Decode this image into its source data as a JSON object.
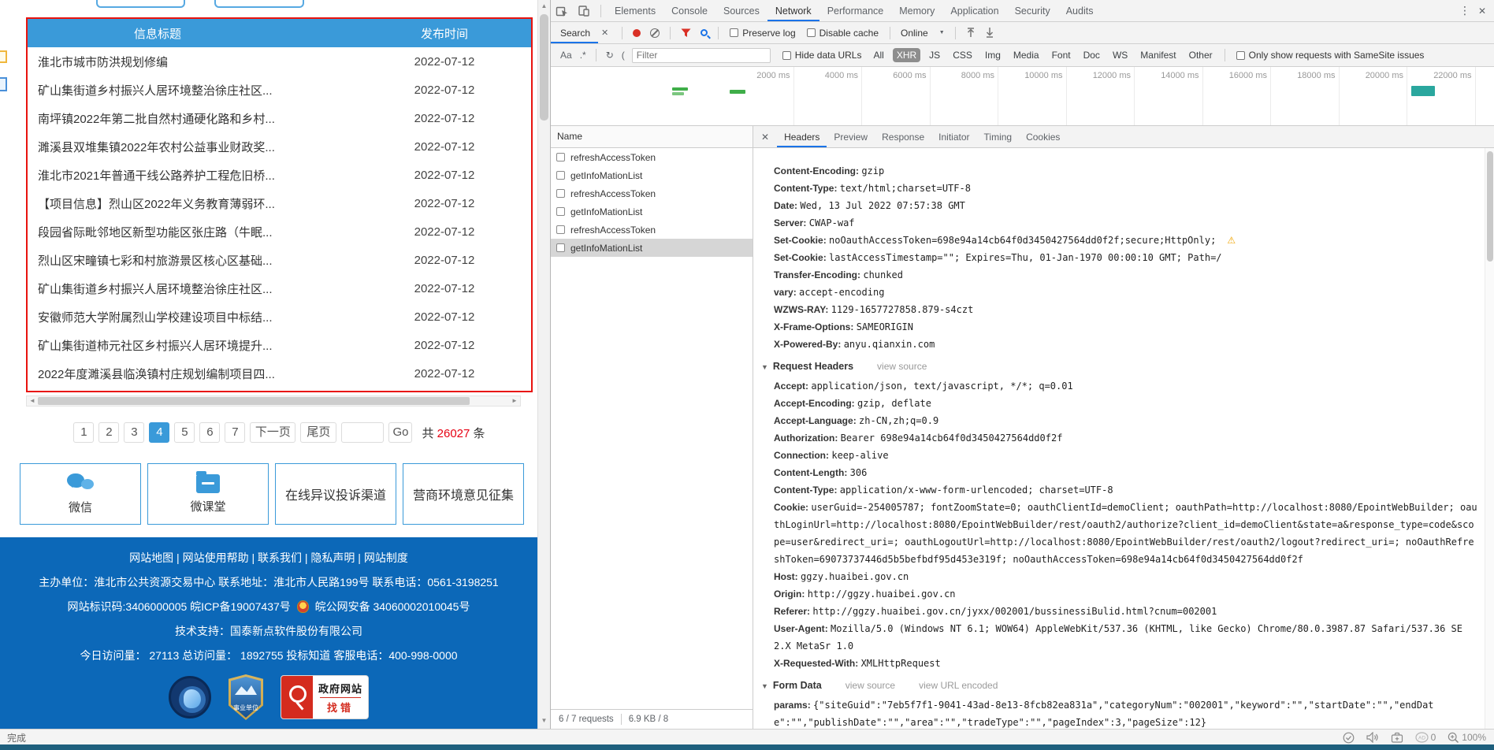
{
  "colors": {
    "accent_blue": "#3a9ad9",
    "footer_blue": "#0c68b8",
    "highlight_border_red": "#e8130e",
    "total_count_red": "#e60012",
    "devtools_accent": "#1a73e8",
    "record_red": "#d93025",
    "timeline_green": "#3fae49",
    "timeline_teal": "#2aa79e"
  },
  "site": {
    "list_header": {
      "title_col": "信息标题",
      "date_col": "发布时间"
    },
    "news": [
      {
        "title": "淮北市城市防洪规划修编",
        "date": "2022-07-12"
      },
      {
        "title": "矿山集街道乡村振兴人居环境整治徐庄社区...",
        "date": "2022-07-12"
      },
      {
        "title": "南坪镇2022年第二批自然村通硬化路和乡村...",
        "date": "2022-07-12"
      },
      {
        "title": "濉溪县双堆集镇2022年农村公益事业财政奖...",
        "date": "2022-07-12"
      },
      {
        "title": "淮北市2021年普通干线公路养护工程危旧桥...",
        "date": "2022-07-12"
      },
      {
        "title": "【项目信息】烈山区2022年义务教育薄弱环...",
        "date": "2022-07-12"
      },
      {
        "title": "段园省际毗邻地区新型功能区张庄路（牛眠...",
        "date": "2022-07-12"
      },
      {
        "title": "烈山区宋疃镇七彩和村旅游景区核心区基础...",
        "date": "2022-07-12"
      },
      {
        "title": "矿山集街道乡村振兴人居环境整治徐庄社区...",
        "date": "2022-07-12"
      },
      {
        "title": "安徽师范大学附属烈山学校建设项目中标结...",
        "date": "2022-07-12"
      },
      {
        "title": "矿山集街道柿元社区乡村振兴人居环境提升...",
        "date": "2022-07-12"
      },
      {
        "title": "2022年度濉溪县临涣镇村庄规划编制项目四...",
        "date": "2022-07-12"
      }
    ],
    "pagination": {
      "pages": [
        {
          "label": "1"
        },
        {
          "label": "2"
        },
        {
          "label": "3"
        },
        {
          "label": "4",
          "active": true
        },
        {
          "label": "5"
        },
        {
          "label": "6"
        },
        {
          "label": "7"
        }
      ],
      "next_label": "下一页",
      "last_label": "尾页",
      "go_label": "Go",
      "total_prefix": "共",
      "total_count": "26027",
      "total_suffix": "条"
    },
    "quick_buttons": {
      "wechat": "微信",
      "classroom": "微课堂",
      "complaint": "在线异议投诉渠道",
      "survey": "营商环境意见征集"
    },
    "footer": {
      "links_line": "网站地图 | 网站使用帮助 | 联系我们 | 隐私声明 | 网站制度",
      "org_line": "主办单位：淮北市公共资源交易中心 联系地址：淮北市人民路199号 联系电话：0561-3198251",
      "code_line_left": "网站标识码:3406000005 皖ICP备19007437号",
      "code_line_right": "皖公网安备 34060002010045号",
      "support_line": "技术支持：国泰新点软件股份有限公司",
      "visits_line": "今日访问量：  27113 总访问量：  1892755 投标知道 客服电话：400-998-0000",
      "badge_shield_label": "事业单位",
      "badge_gov_top": "政府网站",
      "badge_gov_bottom": "找错"
    }
  },
  "devtools": {
    "main_tabs": [
      {
        "label": "Elements"
      },
      {
        "label": "Console"
      },
      {
        "label": "Sources"
      },
      {
        "label": "Network",
        "active": true
      },
      {
        "label": "Performance"
      },
      {
        "label": "Memory"
      },
      {
        "label": "Application"
      },
      {
        "label": "Security"
      },
      {
        "label": "Audits"
      }
    ],
    "search_panel": {
      "tab_label": "Search",
      "match_case": "Aa",
      "regex": ".*",
      "refresh_glyph": "↻",
      "paren": "("
    },
    "network_toolbar": {
      "preserve_log": "Preserve log",
      "disable_cache": "Disable cache",
      "throttling": "Online"
    },
    "filter_bar": {
      "placeholder": "Filter",
      "hide_data_urls": "Hide data URLs",
      "chips": [
        {
          "label": "All"
        },
        {
          "label": "XHR",
          "active": true
        },
        {
          "label": "JS"
        },
        {
          "label": "CSS"
        },
        {
          "label": "Img"
        },
        {
          "label": "Media"
        },
        {
          "label": "Font"
        },
        {
          "label": "Doc"
        },
        {
          "label": "WS"
        },
        {
          "label": "Manifest"
        },
        {
          "label": "Other"
        }
      ],
      "samesite_label": "Only show requests with SameSite issues"
    },
    "timeline": {
      "labels": [
        "2000 ms",
        "4000 ms",
        "6000 ms",
        "8000 ms",
        "10000 ms",
        "12000 ms",
        "14000 ms",
        "16000 ms",
        "18000 ms",
        "20000 ms",
        "22000 ms"
      ]
    },
    "request_list": {
      "name_header": "Name",
      "rows": [
        {
          "name": "refreshAccessToken"
        },
        {
          "name": "getInfoMationList"
        },
        {
          "name": "refreshAccessToken"
        },
        {
          "name": "getInfoMationList"
        },
        {
          "name": "refreshAccessToken"
        },
        {
          "name": "getInfoMationList",
          "selected": true
        }
      ],
      "summary_count": "6 / 7 requests",
      "summary_size": "6.9 KB / 8"
    },
    "detail": {
      "tabs": [
        {
          "label": "Headers",
          "active": true
        },
        {
          "label": "Preview"
        },
        {
          "label": "Response"
        },
        {
          "label": "Initiator"
        },
        {
          "label": "Timing"
        },
        {
          "label": "Cookies"
        }
      ],
      "response_headers": [
        {
          "name": "Content-Encoding",
          "value": "gzip"
        },
        {
          "name": "Content-Type",
          "value": "text/html;charset=UTF-8"
        },
        {
          "name": "Date",
          "value": "Wed, 13 Jul 2022 07:57:38 GMT"
        },
        {
          "name": "Server",
          "value": "CWAP-waf"
        },
        {
          "name": "Set-Cookie",
          "value": "noOauthAccessToken=698e94a14cb64f0d3450427564dd0f2f;secure;HttpOnly;",
          "warning": true
        },
        {
          "name": "Set-Cookie",
          "value": "lastAccessTimestamp=\"\"; Expires=Thu, 01-Jan-1970 00:00:10 GMT; Path=/"
        },
        {
          "name": "Transfer-Encoding",
          "value": "chunked"
        },
        {
          "name": "vary",
          "value": "accept-encoding"
        },
        {
          "name": "WZWS-RAY",
          "value": "1129-1657727858.879-s4czt"
        },
        {
          "name": "X-Frame-Options",
          "value": "SAMEORIGIN"
        },
        {
          "name": "X-Powered-By",
          "value": "anyu.qianxin.com"
        }
      ],
      "request_headers_title": "Request Headers",
      "view_source": "view source",
      "request_headers": [
        {
          "name": "Accept",
          "value": "application/json, text/javascript, */*; q=0.01"
        },
        {
          "name": "Accept-Encoding",
          "value": "gzip, deflate"
        },
        {
          "name": "Accept-Language",
          "value": "zh-CN,zh;q=0.9"
        },
        {
          "name": "Authorization",
          "value": "Bearer 698e94a14cb64f0d3450427564dd0f2f"
        },
        {
          "name": "Connection",
          "value": "keep-alive"
        },
        {
          "name": "Content-Length",
          "value": "306"
        },
        {
          "name": "Content-Type",
          "value": "application/x-www-form-urlencoded; charset=UTF-8"
        },
        {
          "name": "Cookie",
          "value": "userGuid=-254005787; fontZoomState=0; oauthClientId=demoClient; oauthPath=http://localhost:8080/EpointWebBuilder; oauthLoginUrl=http://localhost:8080/EpointWebBuilder/rest/oauth2/authorize?client_id=demoClient&state=a&response_type=code&scope=user&redirect_uri=; oauthLogoutUrl=http://localhost:8080/EpointWebBuilder/rest/oauth2/logout?redirect_uri=; noOauthRefreshToken=69073737446d5b5befbdf95d453e319f; noOauthAccessToken=698e94a14cb64f0d3450427564dd0f2f"
        },
        {
          "name": "Host",
          "value": "ggzy.huaibei.gov.cn"
        },
        {
          "name": "Origin",
          "value": "http://ggzy.huaibei.gov.cn"
        },
        {
          "name": "Referer",
          "value": "http://ggzy.huaibei.gov.cn/jyxx/002001/bussinessiBulid.html?cnum=002001"
        },
        {
          "name": "User-Agent",
          "value": "Mozilla/5.0 (Windows NT 6.1; WOW64) AppleWebKit/537.36 (KHTML, like Gecko) Chrome/80.0.3987.87 Safari/537.36 SE 2.X MetaSr 1.0"
        },
        {
          "name": "X-Requested-With",
          "value": "XMLHttpRequest"
        }
      ],
      "form_data_title": "Form Data",
      "view_url_encoded": "view URL encoded",
      "form_data": [
        {
          "name": "params",
          "value": "{\"siteGuid\":\"7eb5f7f1-9041-43ad-8e13-8fcb82ea831a\",\"categoryNum\":\"002001\",\"keyword\":\"\",\"startDate\":\"\",\"endDate\":\"\",\"publishDate\":\"\",\"area\":\"\",\"tradeType\":\"\",\"pageIndex\":3,\"pageSize\":12}"
        }
      ]
    }
  },
  "window": {
    "statusbar": {
      "done": "完成",
      "ad_label": "AD",
      "ad_count": "0",
      "zoom_level": "100%"
    }
  }
}
